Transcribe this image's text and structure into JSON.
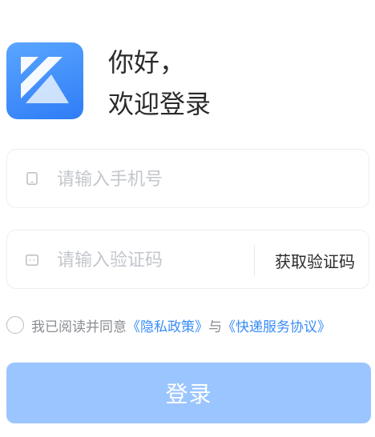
{
  "greeting": {
    "line1": "你好，",
    "line2": "欢迎登录"
  },
  "phone_field": {
    "placeholder": "请输入手机号",
    "value": ""
  },
  "code_field": {
    "placeholder": "请输入验证码",
    "value": ""
  },
  "get_code_label": "获取验证码",
  "agreement": {
    "prefix": "我已阅读并同意",
    "privacy_link": "《隐私政策》",
    "joiner": "与",
    "service_link": "《快递服务协议》",
    "checked": false
  },
  "login_label": "登录",
  "icons": {
    "logo": "k-logo-icon",
    "phone": "phone-icon",
    "code": "message-code-icon"
  },
  "colors": {
    "brand": "#3a8cf6",
    "login_button": "#9bc5ff",
    "placeholder": "#c3c6cc"
  }
}
